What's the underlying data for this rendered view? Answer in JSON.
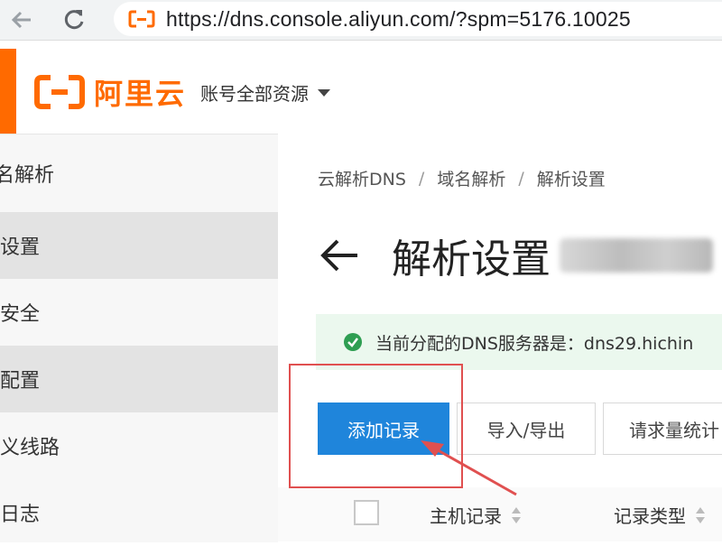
{
  "browser": {
    "url": "https://dns.console.aliyun.com/?spm=5176.10025"
  },
  "header": {
    "logo_text": "阿里云",
    "account_menu": "账号全部资源"
  },
  "sidebar": {
    "items": [
      {
        "label": "名解析"
      },
      {
        "label": "设置",
        "active": true
      },
      {
        "label": "安全"
      },
      {
        "label": "配置",
        "active": true
      },
      {
        "label": "义线路"
      },
      {
        "label": "日志"
      }
    ]
  },
  "main": {
    "breadcrumb": [
      "云解析DNS",
      "域名解析",
      "解析设置"
    ],
    "breadcrumb_sep": "/",
    "title": "解析设置",
    "dns_alert": "当前分配的DNS服务器是：dns29.hichin",
    "buttons": {
      "add_record": "添加记录",
      "import_export": "导入/导出",
      "request_stats": "请求量统计"
    },
    "table": {
      "columns": [
        "主机记录",
        "记录类型"
      ]
    }
  },
  "colors": {
    "brand_orange": "#ff6a00",
    "primary_blue": "#1f85db",
    "alert_bg": "#ebf8ee",
    "success_green": "#2e9e52",
    "annotation_red": "#e05050"
  }
}
